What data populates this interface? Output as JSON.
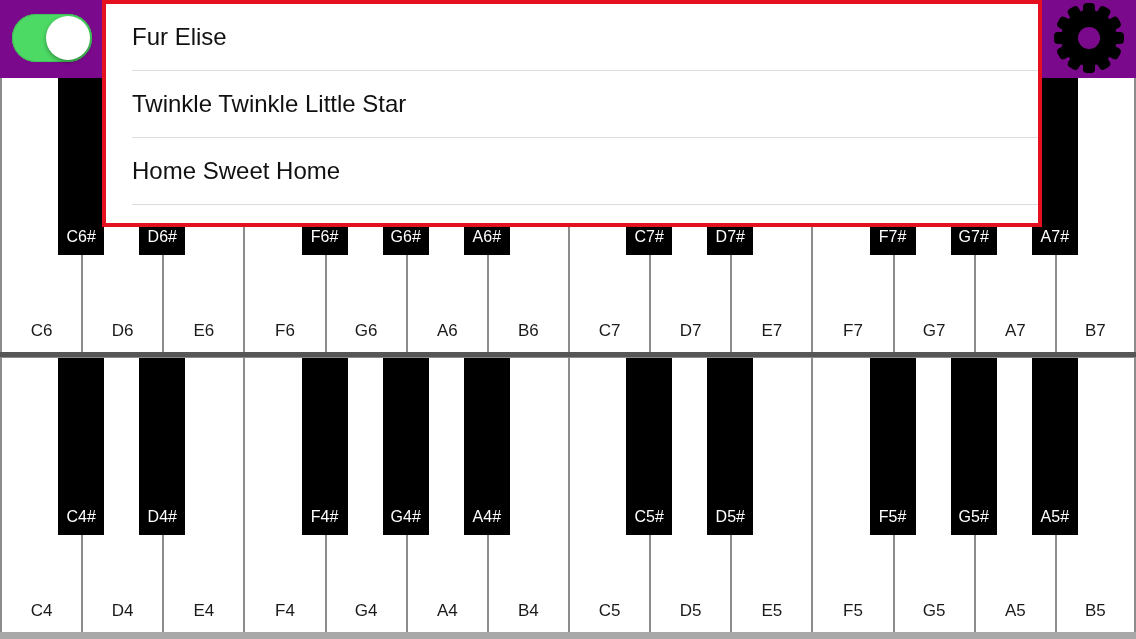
{
  "top_bar": {
    "sound_toggle": {
      "on": true
    }
  },
  "song_menu": {
    "items": [
      "Fur Elise",
      "Twinkle Twinkle Little Star",
      "Home Sweet Home"
    ]
  },
  "keyboards": [
    {
      "keys": [
        {
          "label": "C6",
          "sharp": "C6#"
        },
        {
          "label": "D6",
          "sharp": "D6#"
        },
        {
          "label": "E6"
        },
        {
          "label": "F6",
          "sharp": "F6#"
        },
        {
          "label": "G6",
          "sharp": "G6#"
        },
        {
          "label": "A6",
          "sharp": "A6#"
        },
        {
          "label": "B6"
        },
        {
          "label": "C7",
          "sharp": "C7#"
        },
        {
          "label": "D7",
          "sharp": "D7#"
        },
        {
          "label": "E7"
        },
        {
          "label": "F7",
          "sharp": "F7#"
        },
        {
          "label": "G7",
          "sharp": "G7#"
        },
        {
          "label": "A7",
          "sharp": "A7#"
        },
        {
          "label": "B7"
        }
      ]
    },
    {
      "keys": [
        {
          "label": "C4",
          "sharp": "C4#"
        },
        {
          "label": "D4",
          "sharp": "D4#"
        },
        {
          "label": "E4"
        },
        {
          "label": "F4",
          "sharp": "F4#"
        },
        {
          "label": "G4",
          "sharp": "G4#"
        },
        {
          "label": "A4",
          "sharp": "A4#"
        },
        {
          "label": "B4"
        },
        {
          "label": "C5",
          "sharp": "C5#"
        },
        {
          "label": "D5",
          "sharp": "D5#"
        },
        {
          "label": "E5"
        },
        {
          "label": "F5",
          "sharp": "F5#"
        },
        {
          "label": "G5",
          "sharp": "G5#"
        },
        {
          "label": "A5",
          "sharp": "A5#"
        },
        {
          "label": "B5"
        }
      ]
    }
  ]
}
